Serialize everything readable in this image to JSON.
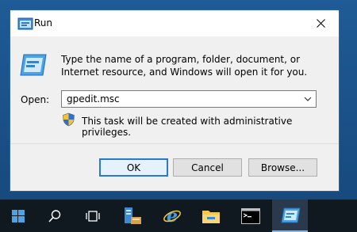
{
  "window": {
    "title": "Run",
    "description": "Type the name of a program, folder, document, or Internet resource, and Windows will open it for you."
  },
  "open": {
    "label": "Open:",
    "value": "gpedit.msc"
  },
  "admin_note": "This task will be created with administrative privileges.",
  "buttons": {
    "ok": "OK",
    "cancel": "Cancel",
    "browse": "Browse..."
  },
  "taskbar": {
    "items": [
      "start-icon",
      "search-icon",
      "task-view-icon",
      "server-manager-icon",
      "internet-explorer-icon",
      "file-explorer-icon",
      "command-prompt-icon",
      "run-icon"
    ]
  },
  "colors": {
    "accent": "#2a78d6",
    "taskbar": "#101820",
    "desktop": "#1b4f86"
  }
}
